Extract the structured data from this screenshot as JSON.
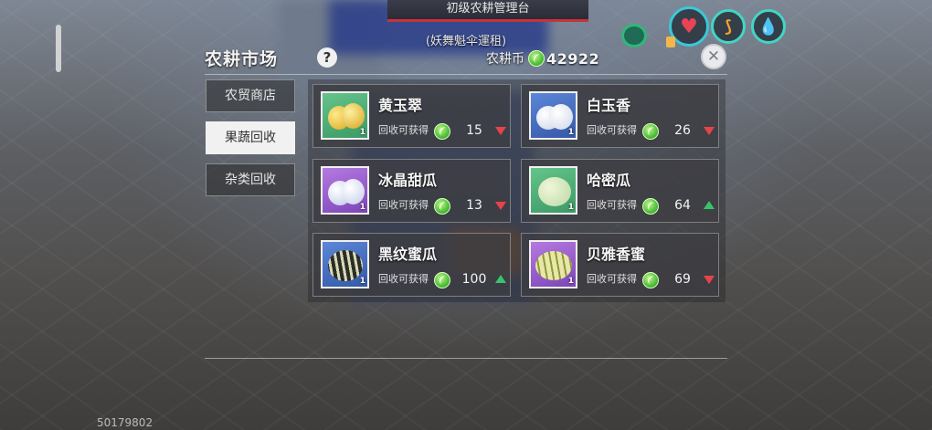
{
  "header": {
    "building_title": "初级农耕管理台",
    "owner_label": "(妖舞魁伞運租)"
  },
  "status_icons": [
    {
      "name": "wifi-icon"
    },
    {
      "name": "heart-icon",
      "color": "#e84455"
    },
    {
      "name": "food-icon",
      "color": "#f2a12a"
    },
    {
      "name": "water-drop-icon",
      "color": "#4fd0f2"
    }
  ],
  "panel": {
    "title": "农耕市场",
    "help_label": "?",
    "currency_label": "农耕币",
    "currency_value": "42922",
    "close_label": "✕"
  },
  "tabs": [
    {
      "label": "农贸商店",
      "active": false
    },
    {
      "label": "果蔬回收",
      "active": true
    },
    {
      "label": "杂类回收",
      "active": false
    }
  ],
  "items": [
    {
      "name": "黄玉翠",
      "reward_label": "回收可获得",
      "value": "15",
      "trend": "down",
      "qty": "1",
      "rarity_color": "green"
    },
    {
      "name": "白玉香",
      "reward_label": "回收可获得",
      "value": "26",
      "trend": "down",
      "qty": "1",
      "rarity_color": "blue"
    },
    {
      "name": "冰晶甜瓜",
      "reward_label": "回收可获得",
      "value": "13",
      "trend": "down",
      "qty": "1",
      "rarity_color": "purple"
    },
    {
      "name": "哈密瓜",
      "reward_label": "回收可获得",
      "value": "64",
      "trend": "up",
      "qty": "1",
      "rarity_color": "green"
    },
    {
      "name": "黑纹蜜瓜",
      "reward_label": "回收可获得",
      "value": "100",
      "trend": "up",
      "qty": "1",
      "rarity_color": "blue"
    },
    {
      "name": "贝雅香蜜",
      "reward_label": "回收可获得",
      "value": "69",
      "trend": "down",
      "qty": "1",
      "rarity_color": "purple"
    }
  ],
  "footer": {
    "build_id": "50179802"
  }
}
